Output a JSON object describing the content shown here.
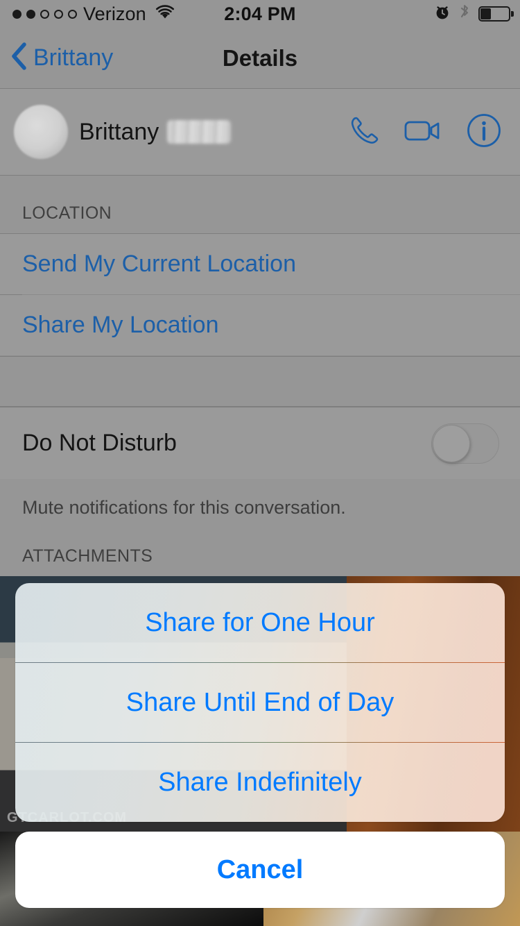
{
  "status_bar": {
    "signal_dots_filled": 2,
    "signal_dots_total": 5,
    "carrier": "Verizon",
    "wifi_icon": "wifi-icon",
    "time": "2:04 PM",
    "alarm_icon": "alarm-clock-icon",
    "bluetooth_icon": "bluetooth-icon",
    "battery_icon": "battery-icon",
    "battery_percent": 35
  },
  "nav_bar": {
    "back_label": "Brittany",
    "back_icon": "chevron-left-icon",
    "title": "Details"
  },
  "contact": {
    "first_name": "Brittany",
    "last_name_redacted": true,
    "avatar_icon": "avatar",
    "actions": [
      {
        "name": "phone-call-icon",
        "label": "Call"
      },
      {
        "name": "video-call-icon",
        "label": "FaceTime"
      },
      {
        "name": "info-icon",
        "label": "Info"
      }
    ]
  },
  "sections": {
    "location": {
      "header": "LOCATION",
      "rows": [
        {
          "label": "Send My Current Location"
        },
        {
          "label": "Share My Location"
        }
      ]
    },
    "do_not_disturb": {
      "label": "Do Not Disturb",
      "toggle_state": "off",
      "footnote": "Mute notifications for this conversation."
    },
    "attachments": {
      "header": "ATTACHMENTS",
      "photo_watermark": "GTCARLOT.COM"
    }
  },
  "action_sheet": {
    "options": [
      {
        "label": "Share for One Hour"
      },
      {
        "label": "Share Until End of Day"
      },
      {
        "label": "Share Indefinitely"
      }
    ],
    "cancel_label": "Cancel"
  },
  "colors": {
    "tint_blue": "#007AFF",
    "dimmed_blue": "#1C5FA8",
    "background_grey": "#969696",
    "cell_grey": "#9A9A9A"
  }
}
